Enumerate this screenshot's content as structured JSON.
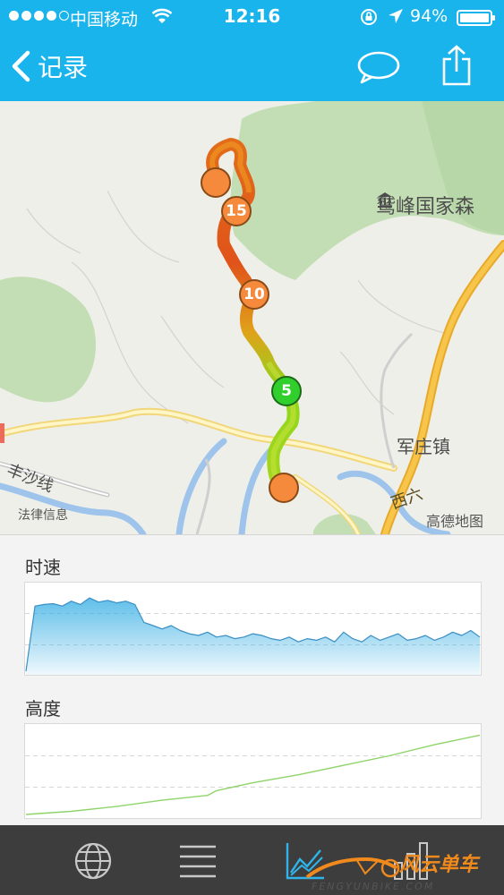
{
  "status_bar": {
    "carrier": "中国移动",
    "time": "12:16",
    "battery": "94%"
  },
  "nav": {
    "back_label": "记录",
    "icons": [
      "back-chevron-icon",
      "comment-bubble-icon",
      "share-icon"
    ]
  },
  "map": {
    "labels": {
      "park": "鹫峰国家森",
      "town": "军庄镇",
      "road": "丰沙线",
      "west": "西六",
      "legal": "法律信息",
      "provider": "高德地图"
    },
    "markers": [
      {
        "kind": "start",
        "label": "",
        "color": "#f58a3c"
      },
      {
        "kind": "km",
        "label": "15",
        "color": "#f58a3c"
      },
      {
        "kind": "km",
        "label": "10",
        "color": "#f58a3c"
      },
      {
        "kind": "km",
        "label": "5",
        "color": "#30cf2c"
      },
      {
        "kind": "end",
        "label": "",
        "color": "#f58a3c"
      }
    ]
  },
  "charts": {
    "speed_title": "时速",
    "elevation_title": "高度"
  },
  "chart_data": [
    {
      "type": "area",
      "title": "时速",
      "x": [
        0,
        2,
        4,
        6,
        8,
        10,
        12,
        14,
        16,
        18,
        20,
        22,
        24,
        26,
        28,
        30,
        32,
        34,
        36,
        38,
        40,
        42,
        44,
        46,
        48,
        50,
        52,
        54,
        56,
        58,
        60,
        62,
        64,
        66,
        68,
        70,
        72,
        74,
        76,
        78,
        80,
        82,
        84,
        86,
        88,
        90,
        92,
        94,
        96,
        98,
        100
      ],
      "values": [
        0,
        80,
        82,
        83,
        80,
        86,
        82,
        90,
        85,
        87,
        84,
        86,
        82,
        60,
        56,
        52,
        56,
        50,
        46,
        44,
        48,
        42,
        44,
        40,
        42,
        46,
        44,
        40,
        38,
        42,
        36,
        40,
        38,
        42,
        36,
        48,
        40,
        36,
        44,
        38,
        42,
        46,
        38,
        40,
        44,
        38,
        42,
        48,
        44,
        50,
        42
      ],
      "ylim": [
        0,
        100
      ],
      "grid": "dashed horizontal",
      "color": "#2aa9e2"
    },
    {
      "type": "line",
      "title": "高度",
      "x": [
        0,
        10,
        20,
        30,
        40,
        42,
        50,
        60,
        70,
        80,
        90,
        100
      ],
      "values": [
        0,
        4,
        10,
        18,
        24,
        30,
        40,
        50,
        62,
        74,
        88,
        100
      ],
      "ylim": [
        0,
        105
      ],
      "grid": "dashed horizontal",
      "color": "#8fd46a"
    }
  ],
  "tab_bar": {
    "icons": [
      "globe-icon",
      "list-icon",
      "chart-icon",
      "bar-chart-icon"
    ],
    "active": "chart-icon"
  },
  "watermark": {
    "brand": "风云单车",
    "url": "FENGYUNBIKE.COM"
  }
}
